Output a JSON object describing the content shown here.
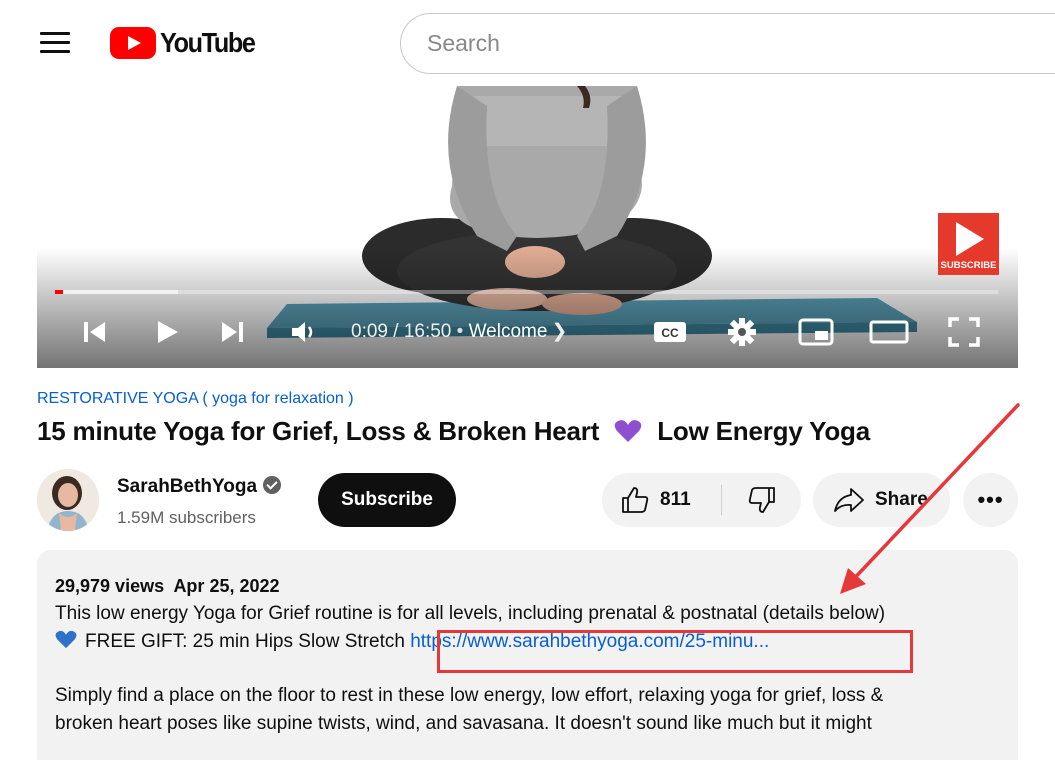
{
  "header": {
    "logo_text": "YouTube",
    "search_placeholder": "Search"
  },
  "video": {
    "badge_text": "SUBSCRIBE",
    "time_current": "0:09",
    "time_total": "16:50",
    "chapter": "Welcome",
    "progress_fraction": 0.009,
    "buffer_fraction": 0.13,
    "cc_label": "CC"
  },
  "meta": {
    "category": "RESTORATIVE YOGA ( yoga for relaxation )",
    "title_part1": "15 minute Yoga for Grief, Loss & Broken Heart",
    "title_part2": "Low Energy Yoga",
    "channel_name": "SarahBethYoga",
    "subscribers": "1.59M subscribers",
    "subscribe_label": "Subscribe",
    "like_count": "811",
    "share_label": "Share",
    "more_label": "•••"
  },
  "description": {
    "views": "29,979 views",
    "date": "Apr 25, 2022",
    "line1": "This low energy Yoga for Grief routine is for all levels, including prenatal & postnatal (details below)",
    "gift_text": "FREE GIFT: 25 min Hips Slow Stretch",
    "gift_link": "https://www.sarahbethyoga.com/25-minu...",
    "line3": "Simply find a place on the floor to rest in these low energy, low effort, relaxing yoga for grief, loss &",
    "line4": "broken heart poses like supine twists, wind, and savasana. It doesn't sound like much but it might"
  },
  "colors": {
    "brand_red": "#ff0000",
    "link_blue": "#065fd4",
    "annotation_red": "#e5383b",
    "purple_heart": "#8e4fd1",
    "blue_heart": "#2d72c8"
  }
}
